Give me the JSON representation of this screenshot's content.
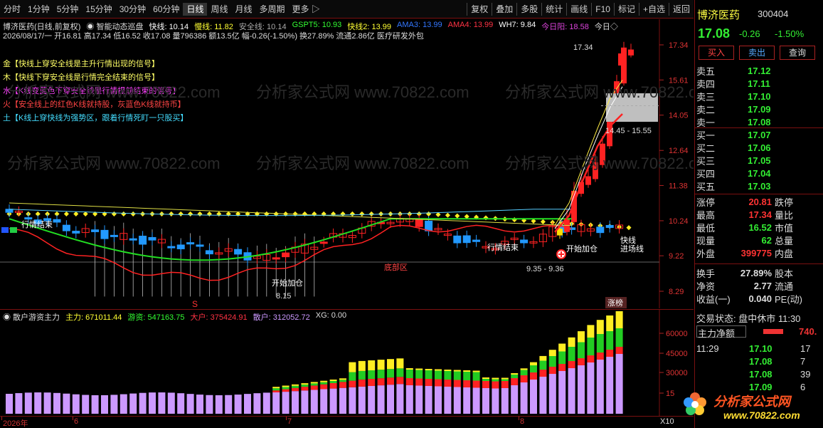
{
  "toolbar": {
    "periods": [
      "分时",
      "1分钟",
      "5分钟",
      "15分钟",
      "30分钟",
      "60分钟",
      "日线",
      "周线",
      "月线",
      "多周期",
      "更多 ▷"
    ],
    "active_index": 6,
    "right": [
      "复权",
      "叠加",
      "多股",
      "统计",
      "画线",
      "F10",
      "标记",
      "+自选",
      "返回"
    ]
  },
  "header": {
    "line1": [
      {
        "t": "博济医药(日线,前复权)",
        "c": "#dddddd"
      },
      {
        "t": "◉ 智能动态巡盘",
        "c": "#dddddd"
      },
      {
        "t": "快线: 10.14",
        "c": "#ffffff"
      },
      {
        "t": "慢线: 11.82",
        "c": "#ffff33"
      },
      {
        "t": "安全线: 10.14",
        "c": "#aaaaaa"
      },
      {
        "t": "GSPT5: 10.93",
        "c": "#33ff33"
      },
      {
        "t": "快线2: 13.99",
        "c": "#ffff33"
      },
      {
        "t": "AMA3: 13.99",
        "c": "#3377ff"
      },
      {
        "t": "AMA4: 13.99",
        "c": "#ff3344"
      },
      {
        "t": "WH7: 9.84",
        "c": "#ffffff"
      },
      {
        "t": "今日阳: 18.58",
        "c": "#dd44dd"
      },
      {
        "t": "今日◇",
        "c": "#dddddd"
      }
    ],
    "line2": "2026/08/17/一 开16.81 高17.34 低16.52 收17.08 量796386 额13.5亿 幅-0.26(-1.50%) 换27.89% 流通2.86亿 医疗研发外包"
  },
  "signals": [
    {
      "t": "金【快线上穿安全线是主升行情出现的信号】",
      "c": "#ffff66"
    },
    {
      "t": "木【快线下穿安全线是行情完全结束的信号】",
      "c": "#ffff66"
    },
    {
      "t": "水【K线变蓝色下穿安全线是行情提前结束的信号】",
      "c": "#ff44ff"
    },
    {
      "t": "火【安全线上的红色K线就持股，灰蓝色K线就持币】",
      "c": "#ff4444"
    },
    {
      "t": "土【K线上穿快线为强势区，跟着行情死盯一只股买】",
      "c": "#44ddff"
    }
  ],
  "price_axis": [
    "17.34",
    "15.61",
    "14.05",
    "12.64",
    "11.38",
    "10.24",
    "9.22",
    "8.29"
  ],
  "annotations": {
    "high": "17.34",
    "range1": "14.45 - 15.55",
    "range2": "9.35 - 9.36",
    "low": "8.15",
    "bottom": "底部区",
    "end1": "行情结束",
    "end2": "行情结束",
    "start1": "开始加仓",
    "start2": "开始加仓",
    "fast": "快线",
    "entry": "进场线",
    "s": "S",
    "zt": "涨榜"
  },
  "sub": {
    "title": "◉ 散户游资主力",
    "items": [
      {
        "t": "主力: 671011.44",
        "c": "#ffff33"
      },
      {
        "t": "游资: 547163.75",
        "c": "#33ff33"
      },
      {
        "t": "大户: 375424.91",
        "c": "#ff3344"
      },
      {
        "t": "散户: 312052.72",
        "c": "#cc99ff"
      },
      {
        "t": "XG: 0.00",
        "c": "#dddddd"
      }
    ],
    "axis": [
      "60000",
      "45000",
      "30000",
      "15"
    ]
  },
  "x_labels": [
    "2026年",
    "6",
    "7",
    "8"
  ],
  "x_corner": "X10",
  "panel": {
    "name": "博济医药",
    "code": "300404",
    "price": "17.08",
    "change": "-0.26",
    "pct": "-1.50%",
    "buttons": [
      "买入",
      "卖出",
      "查询"
    ],
    "asks": [
      {
        "l": "卖五",
        "p": "17.12"
      },
      {
        "l": "卖四",
        "p": "17.11"
      },
      {
        "l": "卖三",
        "p": "17.10"
      },
      {
        "l": "卖二",
        "p": "17.09"
      },
      {
        "l": "卖一",
        "p": "17.08"
      }
    ],
    "bids": [
      {
        "l": "买一",
        "p": "17.07"
      },
      {
        "l": "买二",
        "p": "17.06"
      },
      {
        "l": "买三",
        "p": "17.05"
      },
      {
        "l": "买四",
        "p": "17.04"
      },
      {
        "l": "买五",
        "p": "17.03"
      }
    ],
    "stats": [
      {
        "l": "涨停",
        "v": "20.81",
        "r": "跌停"
      },
      {
        "l": "最高",
        "v": "17.34",
        "r": "量比"
      },
      {
        "l": "最低",
        "v": "16.52",
        "r": "市值"
      },
      {
        "l": "现量",
        "v": "62",
        "r": "总量"
      },
      {
        "l": "外盘",
        "v": "399775",
        "r": "内盘"
      }
    ],
    "stats2": [
      {
        "l": "换手",
        "v": "27.89%",
        "r": "股本"
      },
      {
        "l": "净资",
        "v": "2.77",
        "r": "流通"
      },
      {
        "l": "收益(一)",
        "v": "0.040",
        "r": "PE(动)"
      }
    ],
    "status": "交易状态: 盘中休市 11:30",
    "net_label": "主力净额",
    "net_value": "740.",
    "ticks": [
      {
        "time": "11:29",
        "p": "17.10",
        "v": "17"
      },
      {
        "time": "",
        "p": "17.08",
        "v": "7"
      },
      {
        "time": "",
        "p": "17.08",
        "v": "39"
      },
      {
        "time": "",
        "p": "17.09",
        "v": "6"
      }
    ]
  },
  "watermark": {
    "brand": "分析家公式网",
    "url": "www.70822.com"
  }
}
